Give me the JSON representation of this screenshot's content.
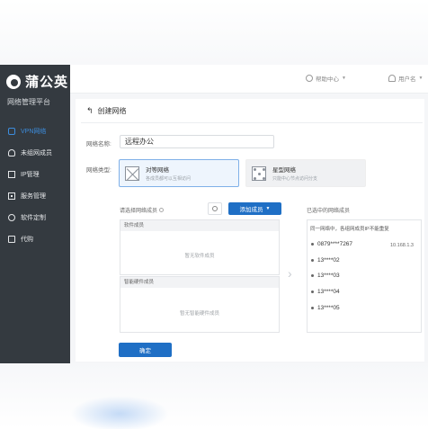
{
  "brand": {
    "name": "蒲公英",
    "subtitle": "网络管理平台"
  },
  "sidebar": {
    "items": [
      {
        "label": "VPN网络",
        "active": true,
        "icon": "vpn-icon"
      },
      {
        "label": "未组网成员",
        "active": false,
        "icon": "user-icon"
      },
      {
        "label": "IP管理",
        "active": false,
        "icon": "ip-icon"
      },
      {
        "label": "服务管理",
        "active": false,
        "icon": "service-icon"
      },
      {
        "label": "软件定制",
        "active": false,
        "icon": "software-icon"
      },
      {
        "label": "代购",
        "active": false,
        "icon": "cart-icon"
      }
    ]
  },
  "header": {
    "help_label": "帮助中心",
    "user_label": "用户名"
  },
  "page": {
    "title": "创建网络"
  },
  "form": {
    "name_label": "网络名称:",
    "name_value": "远程办公",
    "type_label": "网络类型:",
    "types": [
      {
        "title": "对等网络",
        "desc": "各成员都可以互相访问",
        "selected": true
      },
      {
        "title": "星型网络",
        "desc": "只能中心节点访问分支",
        "selected": false
      }
    ]
  },
  "members": {
    "select_label": "请选择网络成员",
    "add_label": "添加成员",
    "software_header": "软件成员",
    "software_empty": "暂无软件成员",
    "hardware_header": "智能硬件成员",
    "hardware_empty": "暂无智能硬件成员"
  },
  "selected": {
    "label": "已选中的网络成员",
    "hint": "同一网络中，各组网成员IP不能重复",
    "items": [
      "0879****7267",
      "13****02",
      "13****03",
      "13****04",
      "13****05"
    ],
    "first_ip": "10.168.1.3"
  },
  "actions": {
    "confirm_label": "确定"
  },
  "colors": {
    "sidebar": "#343a40",
    "primary": "#1f6fc5",
    "active_nav": "#3c8dde"
  }
}
